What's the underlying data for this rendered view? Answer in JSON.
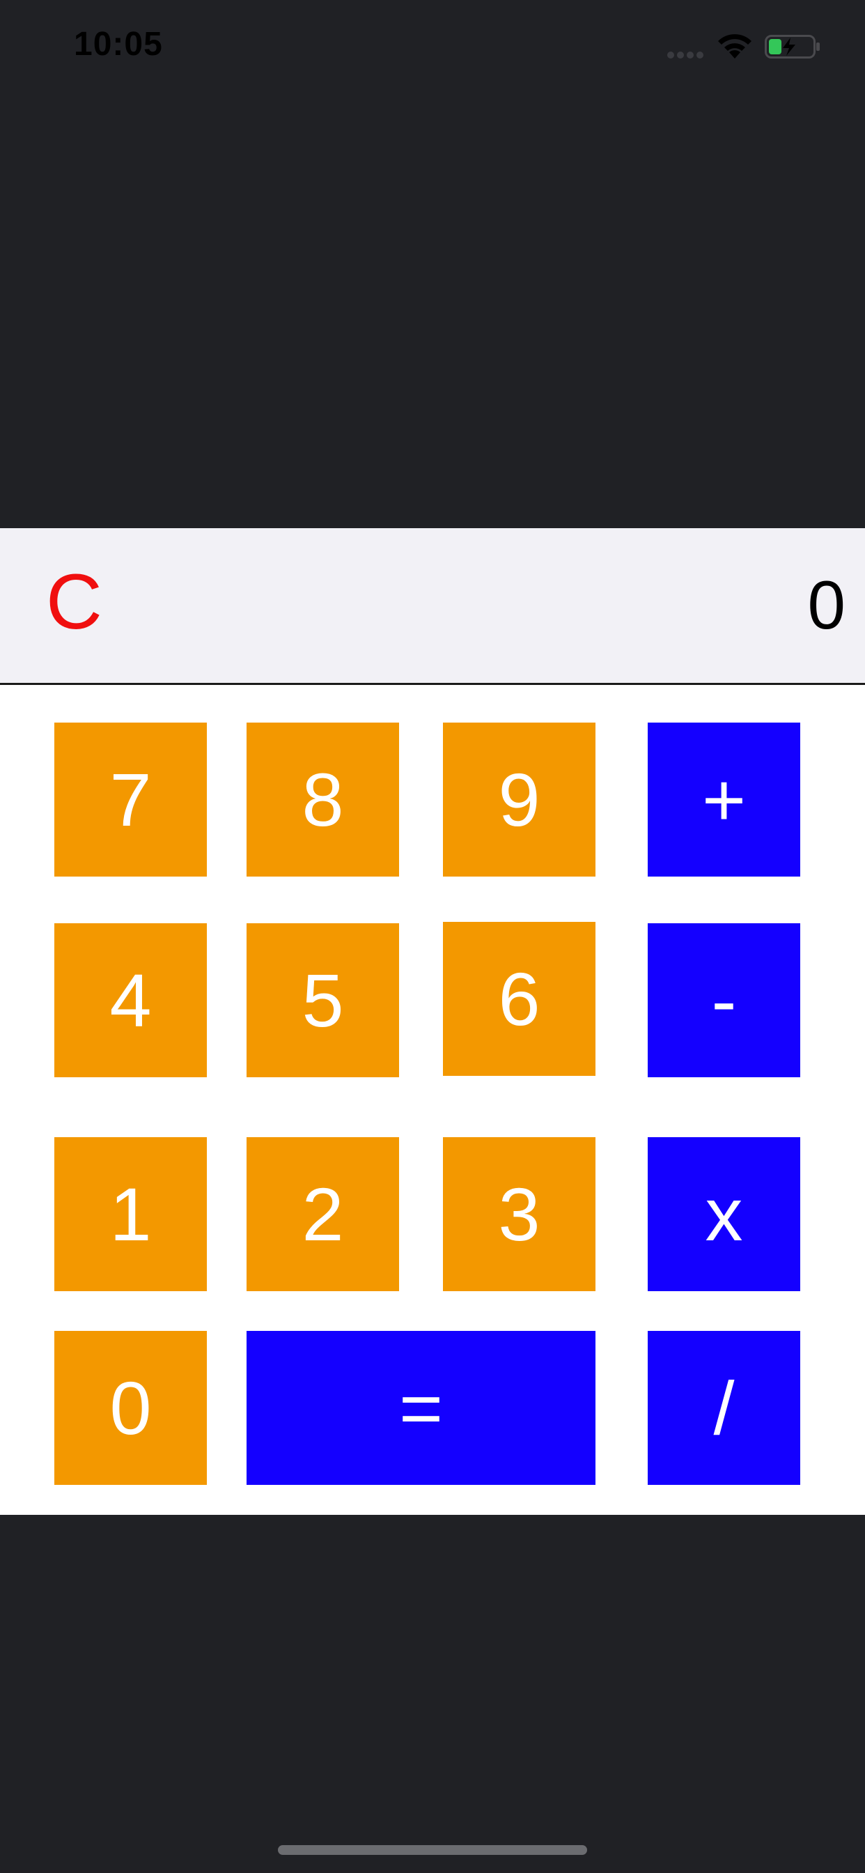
{
  "status_bar": {
    "time": "10:05",
    "icons": [
      "cellular-signal-icon",
      "wifi-icon",
      "battery-charging-icon"
    ]
  },
  "display": {
    "clear_label": "C",
    "value": "0"
  },
  "keypad": {
    "rows": [
      [
        "7",
        "8",
        "9",
        "+"
      ],
      [
        "4",
        "5",
        "6",
        "-"
      ],
      [
        "1",
        "2",
        "3",
        "x"
      ],
      [
        "0",
        "=",
        "/"
      ]
    ]
  },
  "colors": {
    "background": "#202125",
    "display_background": "#f2f1f6",
    "keypad_background": "#ffffff",
    "number_key": "#f39800",
    "operator_key": "#1400ff",
    "clear_text": "#f00f0f",
    "key_text": "#ffffff",
    "battery_fill": "#34c759"
  }
}
